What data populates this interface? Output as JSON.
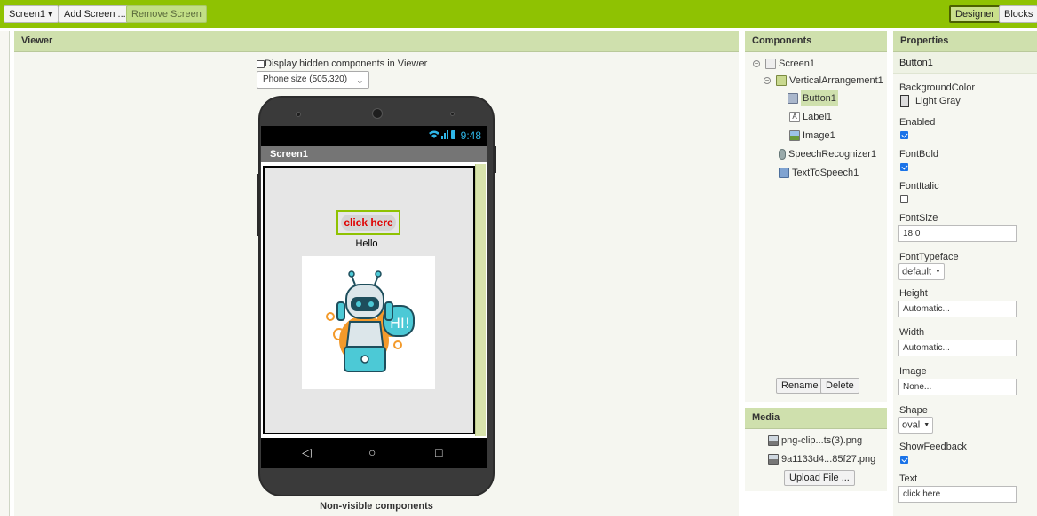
{
  "toolbar": {
    "screen_select": "Screen1 ▾",
    "add_screen": "Add Screen ...",
    "remove_screen": "Remove Screen",
    "designer": "Designer",
    "blocks": "Blocks"
  },
  "viewer": {
    "header": "Viewer",
    "display_hidden": "Display hidden components in Viewer",
    "phone_size": "Phone size (505,320)",
    "time": "9:48",
    "screen_title": "Screen1",
    "button_text": "click here",
    "label_text": "Hello",
    "non_visible": "Non-visible components"
  },
  "components": {
    "header": "Components",
    "tree": [
      "Screen1",
      "VerticalArrangement1",
      "Button1",
      "Label1",
      "Image1",
      "SpeechRecognizer1",
      "TextToSpeech1"
    ],
    "rename": "Rename",
    "delete": "Delete"
  },
  "media": {
    "header": "Media",
    "files": [
      "png-clip...ts(3).png",
      "9a1133d4...85f27.png"
    ],
    "upload": "Upload File ..."
  },
  "properties": {
    "header": "Properties",
    "component": "Button1",
    "background_color_label": "BackgroundColor",
    "background_color_value": "Light Gray",
    "enabled_label": "Enabled",
    "fontbold_label": "FontBold",
    "fontitalic_label": "FontItalic",
    "fontsize_label": "FontSize",
    "fontsize_value": "18.0",
    "fonttypeface_label": "FontTypeface",
    "fonttypeface_value": "default",
    "height_label": "Height",
    "height_value": "Automatic...",
    "width_label": "Width",
    "width_value": "Automatic...",
    "image_label": "Image",
    "image_value": "None...",
    "shape_label": "Shape",
    "shape_value": "oval",
    "showfeedback_label": "ShowFeedback",
    "text_label": "Text",
    "text_value": "click here"
  },
  "colors": {
    "accent": "#8fc202",
    "panel_header": "#cfe0ad",
    "button_text": "#e00000"
  }
}
